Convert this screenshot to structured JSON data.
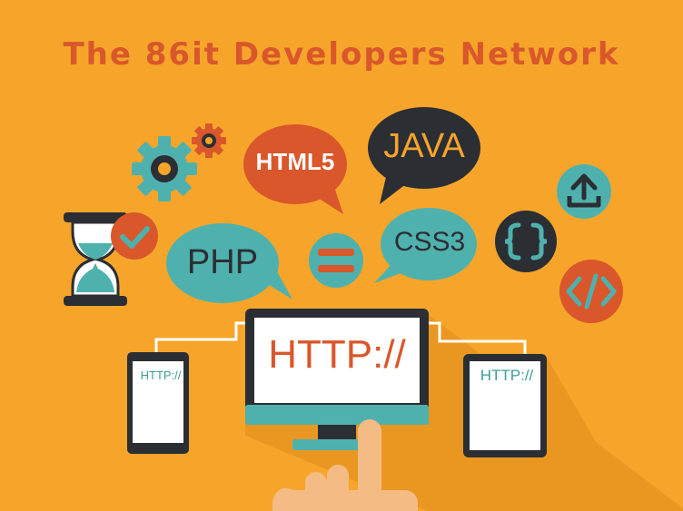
{
  "title": "The 86it Developers Network",
  "labels": {
    "html5": "HTML5",
    "java": "JAVA",
    "php": "PHP",
    "css3": "CSS3",
    "http_main": "HTTP://",
    "http_phone": "HTTP://",
    "http_tablet": "HTTP://"
  },
  "icons": [
    "gear-icon",
    "small-gear-icon",
    "hourglass-icon",
    "check-icon",
    "equals-icon",
    "curly-braces-icon",
    "upload-icon",
    "code-icon",
    "monitor-icon",
    "phone-icon",
    "tablet-icon",
    "hand-pointer-icon"
  ],
  "colors": {
    "background": "#f7a52a",
    "accent_red": "#d9572b",
    "teal": "#4fb1ad",
    "dark": "#2b2e33",
    "white": "#ffffff"
  }
}
